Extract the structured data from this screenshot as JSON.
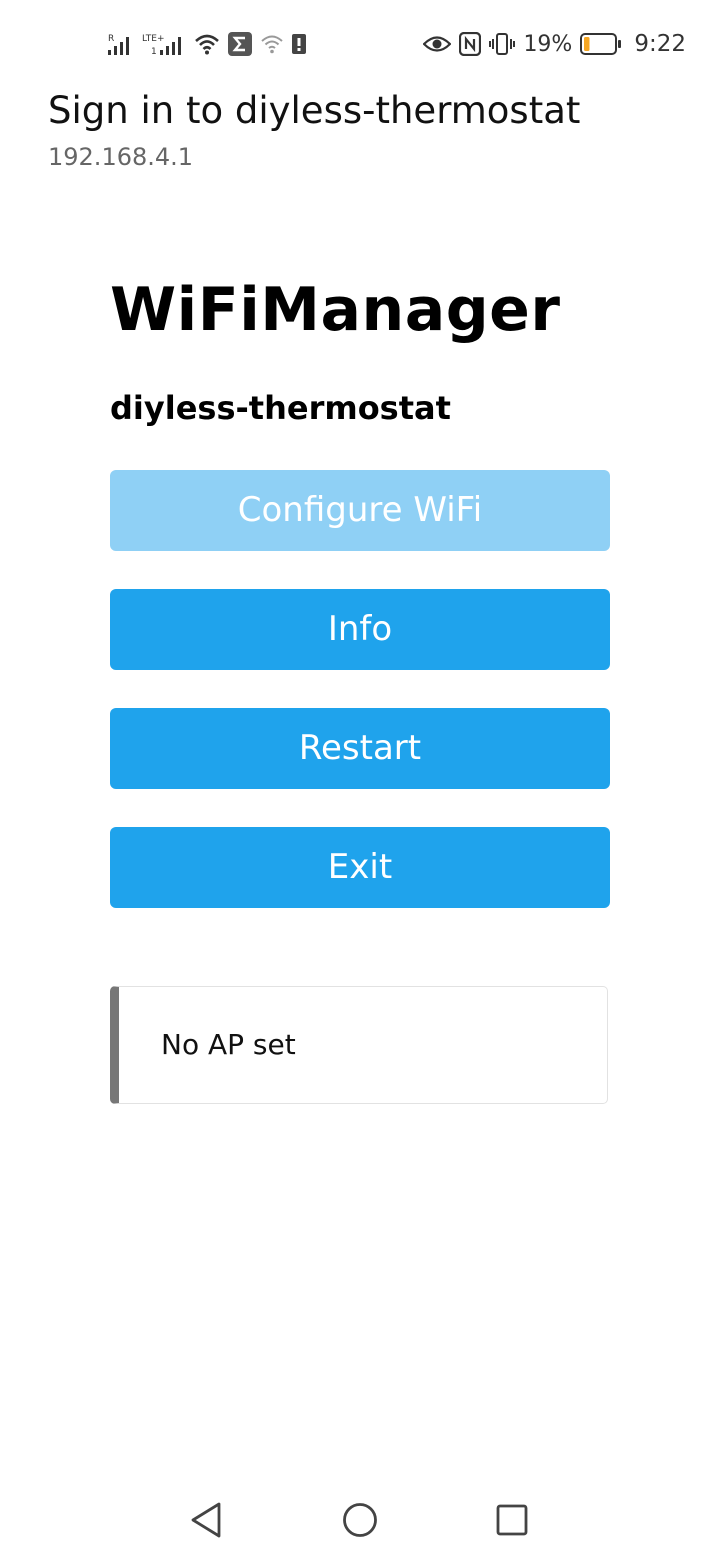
{
  "status_bar": {
    "roaming_label": "R",
    "network_label": "LTE+",
    "sim_label": "1",
    "battery_percent": "19%",
    "battery_level": 0.19,
    "time": "9:22",
    "icons": [
      "signal-icon",
      "lte-signal-icon",
      "wifi-icon",
      "sigma-app-icon",
      "wifi-question-icon",
      "alert-icon",
      "eye-icon",
      "nfc-icon",
      "vibrate-icon",
      "battery-icon"
    ],
    "accent_battery_color": "#f5a623"
  },
  "portal": {
    "title": "Sign in to diyless-thermostat",
    "address": "192.168.4.1"
  },
  "page": {
    "heading": "WiFiManager",
    "device_name": "diyless-thermostat",
    "buttons": {
      "configure": "Configure WiFi",
      "info": "Info",
      "restart": "Restart",
      "exit": "Exit"
    },
    "message": "No AP set",
    "colors": {
      "button": "#1fa3ec",
      "button_disabled": "#8fd0f5",
      "message_border": "#777777"
    }
  },
  "nav": {
    "icons": [
      "back-icon",
      "home-icon",
      "recents-icon"
    ]
  }
}
